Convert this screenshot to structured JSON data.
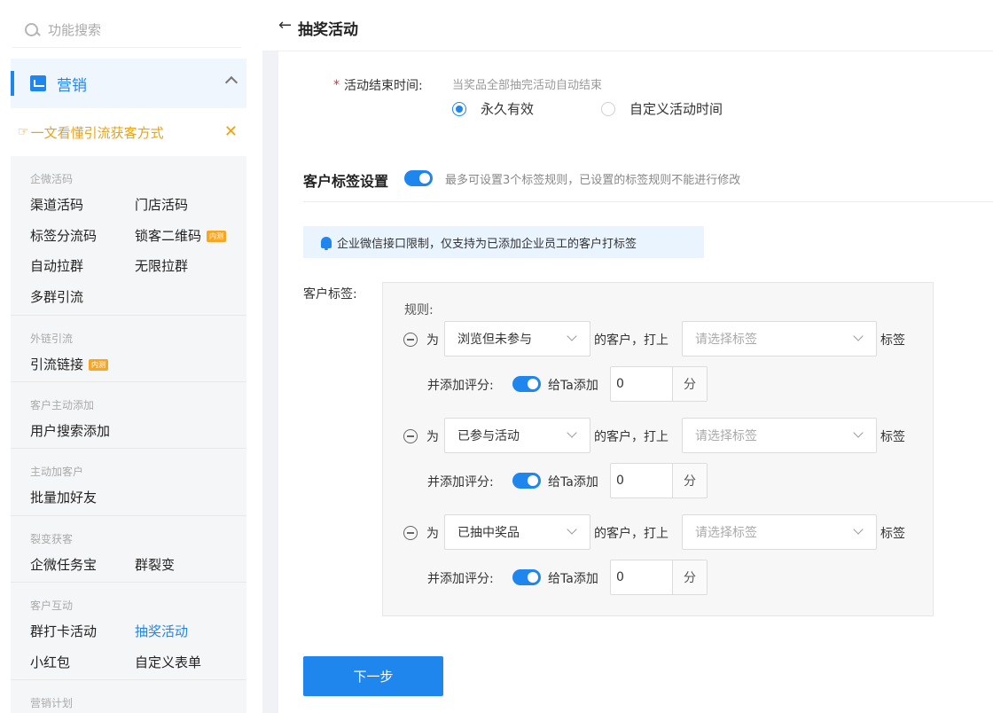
{
  "sidebar": {
    "search_placeholder": "功能搜索",
    "menu_label": "营销",
    "tip_text": "一文看懂引流获客方式",
    "tip_icon": "☞",
    "close_glyph": "✕",
    "groups": [
      {
        "title": "企微活码",
        "items": [
          "渠道活码",
          "门店活码",
          "标签分流码",
          "锁客二维码",
          "自动拉群",
          "无限拉群",
          "多群引流"
        ],
        "badge": "内测"
      },
      {
        "title": "外链引流",
        "items": [
          "引流链接"
        ],
        "badge": "内测"
      },
      {
        "title": "客户主动添加",
        "items": [
          "用户搜索添加"
        ]
      },
      {
        "title": "主动加客户",
        "items": [
          "批量加好友"
        ]
      },
      {
        "title": "裂变获客",
        "items": [
          "企微任务宝",
          "群裂变"
        ]
      },
      {
        "title": "客户互动",
        "items": [
          "群打卡活动",
          "抽奖活动",
          "小红包",
          "自定义表单"
        ]
      },
      {
        "title": "营销计划",
        "items": []
      }
    ]
  },
  "header": {
    "back_glyph": "←",
    "title": "抽奖活动"
  },
  "form": {
    "required_mark": "*",
    "end_time_label": "活动结束时间:",
    "end_time_hint": "当奖品全部抽完活动自动结束",
    "radio_permanent": "永久有效",
    "radio_custom": "自定义活动时间",
    "section_title": "客户标签设置",
    "section_hint": "最多可设置3个标签规则，已设置的标签规则不能进行修改",
    "notice": "企业微信接口限制，仅支持为已添加企业员工的客户打标签",
    "customer_tag_label": "客户标签:",
    "rules_label": "规则:",
    "rules": [
      {
        "prefix": "为",
        "condition": "浏览但未参与",
        "middle": "的客户，打上",
        "tag_placeholder": "请选择标签",
        "suffix": "标签",
        "score_label": "并添加评分:",
        "give_label": "给Ta添加",
        "score": "0",
        "unit": "分"
      },
      {
        "prefix": "为",
        "condition": "已参与活动",
        "middle": "的客户，打上",
        "tag_placeholder": "请选择标签",
        "suffix": "标签",
        "score_label": "并添加评分:",
        "give_label": "给Ta添加",
        "score": "0",
        "unit": "分"
      },
      {
        "prefix": "为",
        "condition": "已抽中奖品",
        "middle": "的客户，打上",
        "tag_placeholder": "请选择标签",
        "suffix": "标签",
        "score_label": "并添加评分:",
        "give_label": "给Ta添加",
        "score": "0",
        "unit": "分"
      }
    ],
    "next_button": "下一步"
  },
  "colors": {
    "accent": "#1f86ee",
    "warning": "#e8a318",
    "badge": "#f5a623",
    "required": "#f5222d"
  }
}
